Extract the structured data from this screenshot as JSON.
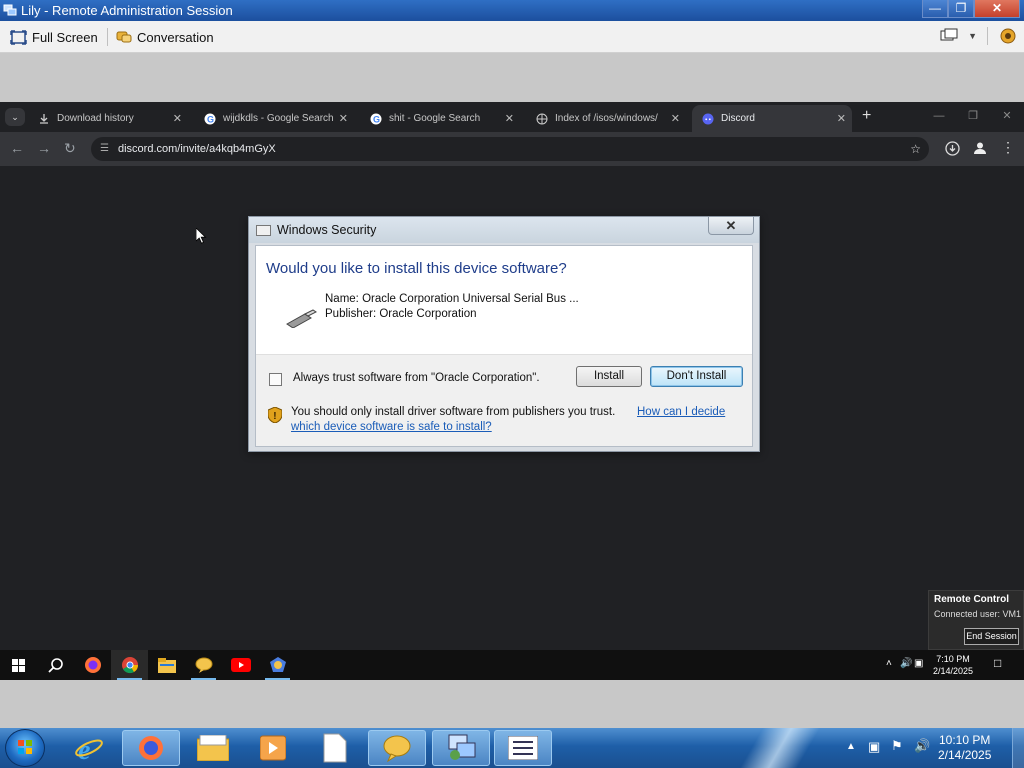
{
  "outer_window": {
    "title": "Lily - Remote Administration Session",
    "minimize": "—",
    "maximize": "❐",
    "close": "✕"
  },
  "ra_toolbar": {
    "full_screen_label": "Full Screen",
    "conversation_label": "Conversation"
  },
  "browser": {
    "tabs": [
      {
        "label": "Download history",
        "icon": "download-icon",
        "close": "✕"
      },
      {
        "label": "wijdkdls - Google Search",
        "icon": "google-icon",
        "close": "✕"
      },
      {
        "label": "shit - Google Search",
        "icon": "google-icon",
        "close": "✕"
      },
      {
        "label": "Index of /isos/windows/",
        "icon": "globe-icon",
        "close": "✕"
      },
      {
        "label": "Discord",
        "icon": "discord-icon",
        "close": "✕"
      }
    ],
    "active_tab_index": 4,
    "new_tab": "+",
    "url": "discord.com/invite/a4kqb4mGyX"
  },
  "dialog": {
    "title": "Windows Security",
    "close": "✕",
    "question": "Would you like to install this device software?",
    "name_line": "Name: Oracle Corporation Universal Serial Bus ...",
    "publisher_line": "Publisher: Oracle Corporation",
    "checkbox_label": "Always trust software from \"Oracle Corporation\".",
    "checkbox_checked": false,
    "install_label": "Install",
    "dont_install_label": "Don't Install",
    "warning_text": "You should only install driver software from publishers you trust.",
    "link_part1": "How can I decide",
    "link_part2": "which device software is safe to install?"
  },
  "remote_control": {
    "title": "Remote Control",
    "user": "Connected user: VM1",
    "end_session_label": "End Session"
  },
  "remote_taskbar": {
    "time": "7:10 PM",
    "date": "2/14/2025"
  },
  "host_taskbar": {
    "time": "10:10 PM",
    "date": "2/14/2025"
  }
}
